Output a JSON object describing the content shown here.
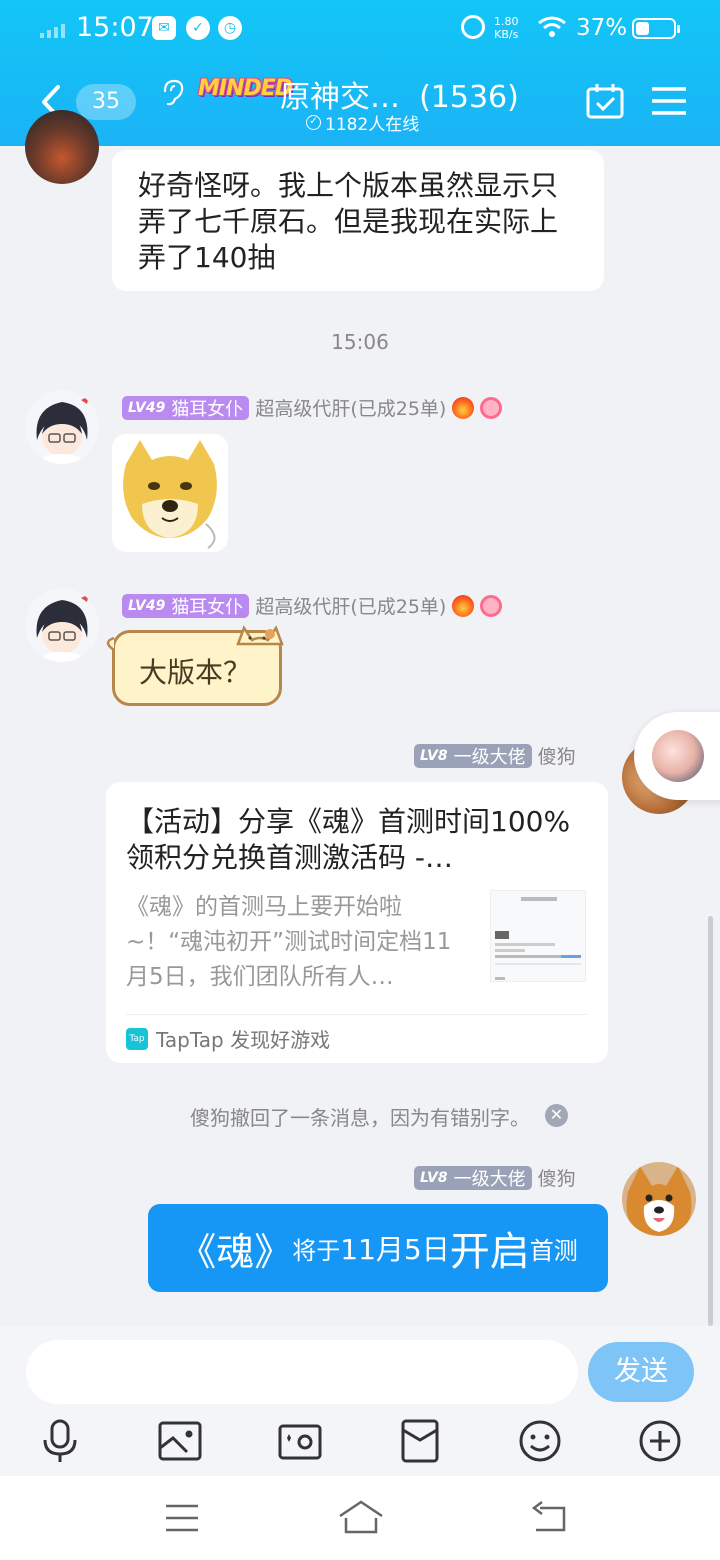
{
  "status_bar": {
    "time": "15:07",
    "net_speed_value": "1.80",
    "net_speed_unit": "KB/s",
    "battery": "37%"
  },
  "header": {
    "back_count": "35",
    "logo_text": "MINDED",
    "group_title": "原神交…",
    "member_count": "(1536)",
    "online_count": "1182人在线"
  },
  "messages": {
    "m1_text": "好奇怪呀。我上个版本虽然显示只弄了七千原石。但是我现在实际上弄了140抽",
    "timestamp": "15:06",
    "m2": {
      "level": "LV49",
      "title": "猫耳女仆",
      "nickname": "超高级代肝(已成25单)"
    },
    "m3": {
      "level": "LV49",
      "title": "猫耳女仆",
      "nickname": "超高级代肝(已成25单)",
      "text": "大版本？"
    },
    "m4": {
      "level": "LV8",
      "title": "一级大佬",
      "nickname": "傻狗",
      "card_title": "【活动】分享《魂》首测时间100%领积分兑换首测激活码 -…",
      "card_desc": "《魂》的首测马上要开始啦~！“魂沌初开”测试时间定档11月5日，我们团队所有人…",
      "card_source": "TapTap 发现好游戏",
      "card_tap_logo": "Tap"
    },
    "recall_notice": "傻狗撤回了一条消息，因为有错别字。",
    "m5": {
      "level": "LV8",
      "title": "一级大佬",
      "nickname": "傻狗",
      "part1": "《魂》",
      "part2": "将于",
      "part3": "11月5日",
      "part4": "开启",
      "part5": "首测"
    }
  },
  "input": {
    "placeholder": "",
    "send_label": "发送"
  },
  "colors": {
    "header": "#12c6f7",
    "accent_blue": "#1696f5",
    "send_disabled": "#7fc4f6",
    "background": "#f1f2f6"
  }
}
